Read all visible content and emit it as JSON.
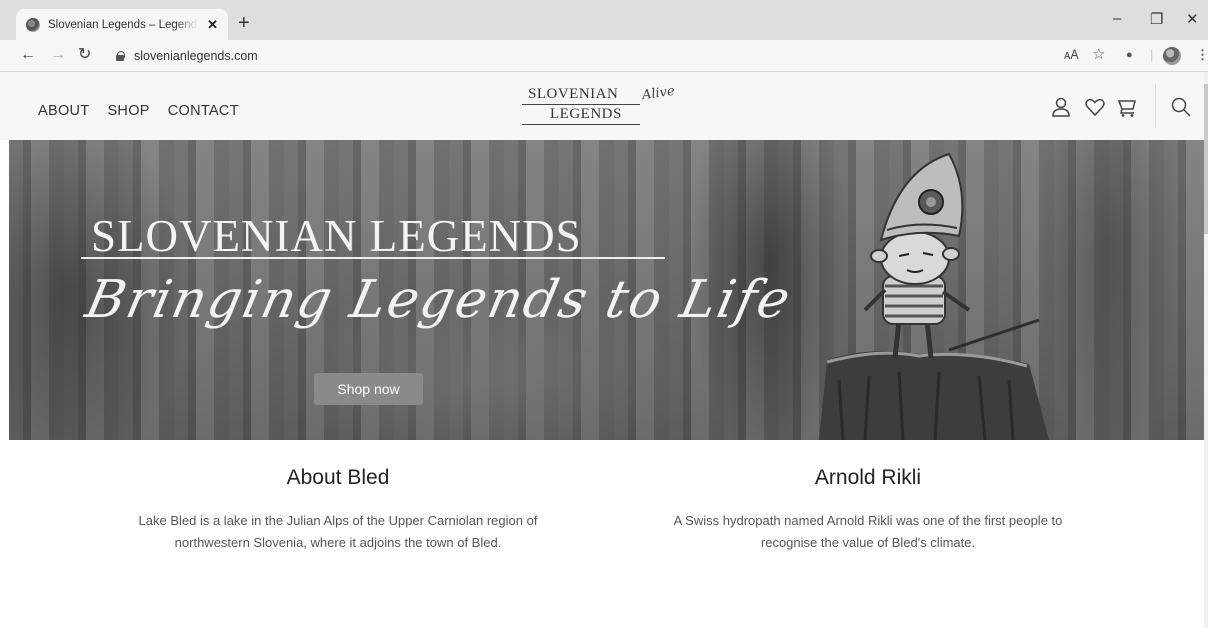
{
  "browser": {
    "tab_title": "Slovenian Legends – Legends bro",
    "tab_close": "✕",
    "new_tab": "+",
    "url": "slovenianlegends.com",
    "window_controls": [
      "–",
      "❐",
      "✕"
    ]
  },
  "site": {
    "nav": [
      "ABOUT",
      "SHOP",
      "CONTACT"
    ],
    "logo": {
      "line1": "SLOVENIAN",
      "line2": "LEGENDS",
      "script": "Alive"
    },
    "header_icons": [
      "user-icon",
      "heart-icon",
      "cart-icon",
      "search-icon"
    ]
  },
  "hero": {
    "title": "SLOVENIAN LEGENDS",
    "subtitle": "Bringing Legends to Life",
    "button": "Shop now"
  },
  "sections": [
    {
      "title": "About Bled",
      "text1": "Lake Bled is a lake in the Julian Alps of the Upper Carniolan region of",
      "text2": "northwestern Slovenia, where it adjoins the town of Bled."
    },
    {
      "title": "Arnold Rikli",
      "text1": "A Swiss hydropath named Arnold Rikli was one of the first people to",
      "text2": "recognise the value of Bled's climate."
    }
  ]
}
